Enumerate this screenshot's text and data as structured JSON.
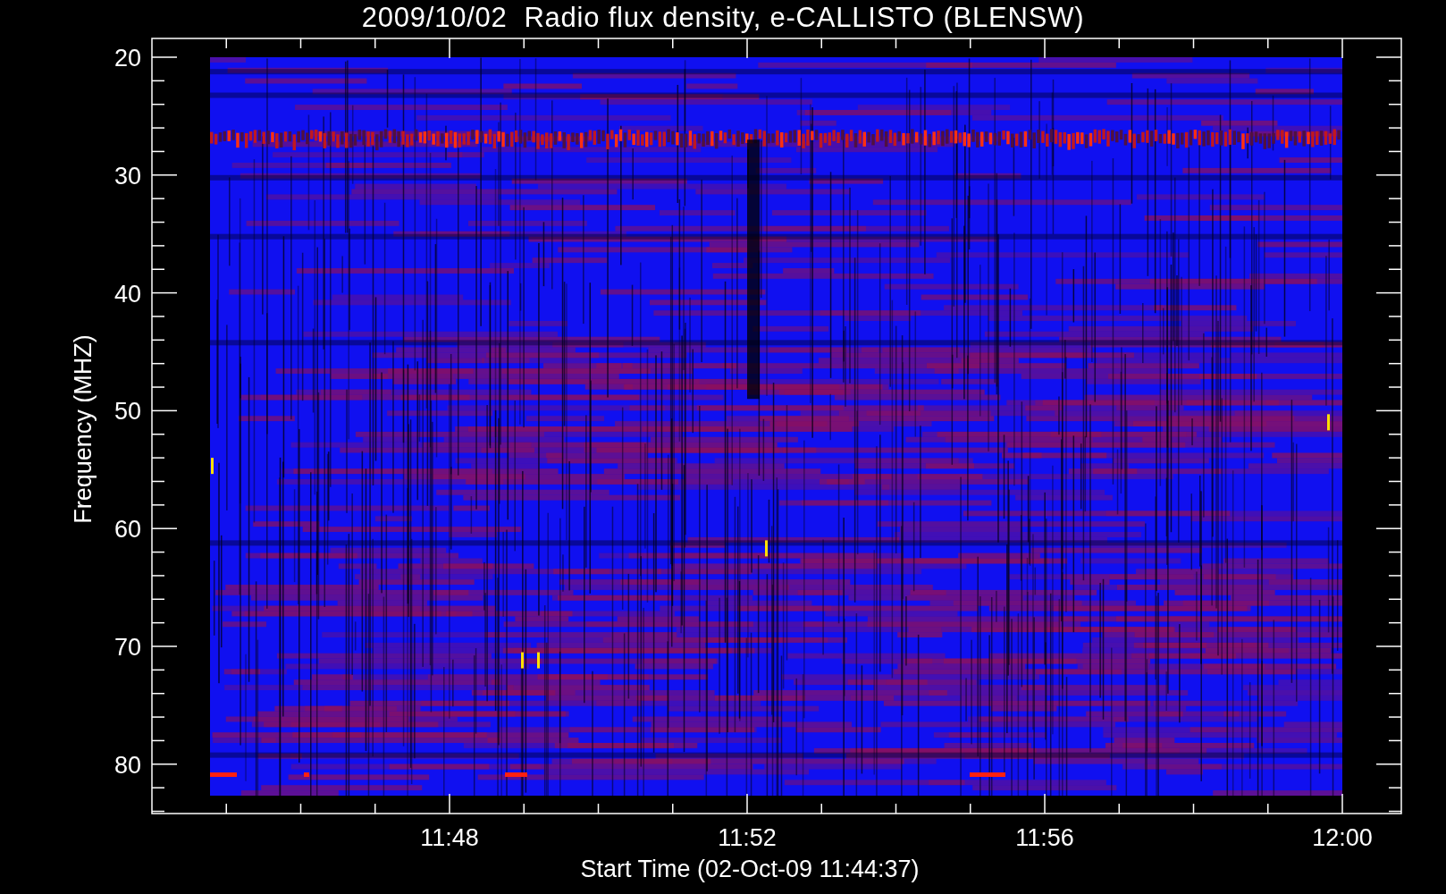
{
  "title": "2009/10/02  Radio flux density, e-CALLISTO (BLENSW)",
  "y_axis": {
    "label": "Frequency (MHZ)",
    "ticks": [
      "20",
      "30",
      "40",
      "50",
      "60",
      "70",
      "80"
    ]
  },
  "x_axis": {
    "label": "Start Time (02-Oct-09 11:44:37)",
    "ticks": [
      "11:48",
      "11:52",
      "11:56",
      "12:00"
    ]
  }
}
